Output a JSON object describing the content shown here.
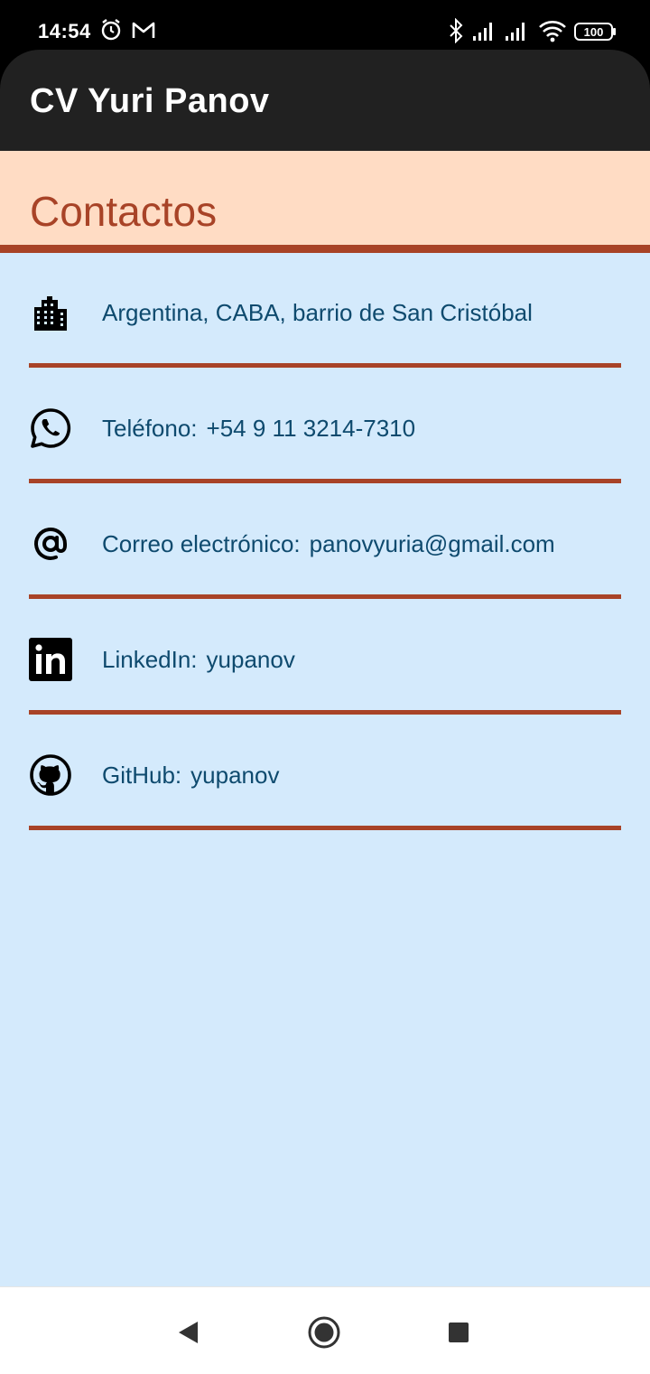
{
  "status_bar": {
    "time": "14:54",
    "icons": [
      "alarm-icon",
      "gmail-icon",
      "bluetooth-icon",
      "signal-icon",
      "signal-icon",
      "wifi-icon",
      "battery-icon"
    ],
    "battery": "100"
  },
  "app_bar": {
    "title": "CV Yuri Panov"
  },
  "section": {
    "title": "Contactos"
  },
  "contacts": [
    {
      "icon": "building-icon",
      "label": "",
      "value": "Argentina, CABA, barrio de San Cristóbal"
    },
    {
      "icon": "whatsapp-icon",
      "label": "Teléfono:",
      "value": "+54 9 11 3214-7310"
    },
    {
      "icon": "at-sign-icon",
      "label": "Correo electrónico:",
      "value": "panovyuria@gmail.com"
    },
    {
      "icon": "linkedin-icon",
      "label": "LinkedIn:",
      "value": "yupanov"
    },
    {
      "icon": "github-icon",
      "label": "GitHub:",
      "value": "yupanov"
    }
  ],
  "nav_bar": {
    "buttons": [
      "back-icon",
      "home-icon",
      "recents-icon"
    ]
  },
  "colors": {
    "accent": "#a84327",
    "header_bg": "#ffdcc4",
    "body_bg": "#d4eafc",
    "text": "#0e4a6e",
    "app_bar": "#212121"
  }
}
